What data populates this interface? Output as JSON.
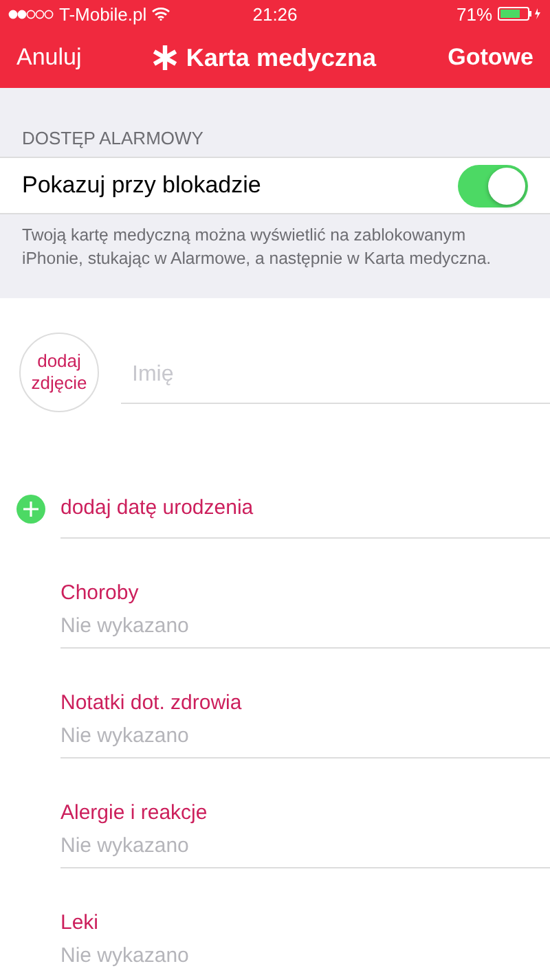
{
  "status_bar": {
    "carrier": "T-Mobile.pl",
    "time": "21:26",
    "battery": "71%"
  },
  "nav": {
    "cancel": "Anuluj",
    "title": "Karta medyczna",
    "done": "Gotowe"
  },
  "emergency": {
    "header": "DOSTĘP ALARMOWY",
    "toggle": {
      "label": "Pokazuj przy blokadzie",
      "on": true
    },
    "footnote": "Twoją kartę medyczną można wyświetlić na zablokowanym iPhonie, stukając w Alarmowe, a następnie w Karta medyczna."
  },
  "profile": {
    "photo": "dodaj zdjęcie",
    "name_placeholder": "Imię"
  },
  "birth_date": "dodaj datę urodzenia",
  "fields": [
    {
      "label": "Choroby",
      "value": "Nie wykazano"
    },
    {
      "label": "Notatki dot. zdrowia",
      "value": "Nie wykazano"
    },
    {
      "label": "Alergie i reakcje",
      "value": "Nie wykazano"
    },
    {
      "label": "Leki",
      "value": "Nie wykazano"
    }
  ]
}
